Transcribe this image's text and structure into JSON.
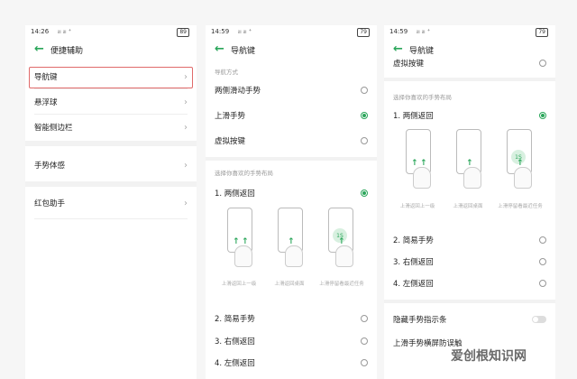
{
  "p1": {
    "status": {
      "time": "14:26",
      "signal": "ᵢₗₗ ᵢₗₗ ⁺",
      "battery": "89"
    },
    "title": "便捷辅助",
    "items": [
      {
        "label": "导航键"
      },
      {
        "label": "悬浮球"
      },
      {
        "label": "智能侧边栏"
      },
      {
        "label": "手势体感"
      },
      {
        "label": "红包助手"
      }
    ]
  },
  "p2": {
    "status": {
      "time": "14:59",
      "signal": "ᵢₗₗ ᵢₗₗ ⁺",
      "battery": "79"
    },
    "title": "导航键",
    "section1": "导航方式",
    "modes": [
      {
        "label": "两侧滑动手势",
        "on": false
      },
      {
        "label": "上滑手势",
        "on": true
      },
      {
        "label": "虚拟按键",
        "on": false
      }
    ],
    "section2": "选择你喜欢的手势布局",
    "layouts": [
      {
        "label": "1. 两侧返回",
        "on": true
      },
      {
        "label": "2. 简易手势",
        "on": false
      },
      {
        "label": "3. 右侧返回",
        "on": false
      },
      {
        "label": "4. 左侧返回",
        "on": false
      }
    ],
    "captions": [
      "上滑返回上一级",
      "上滑返回桌面",
      "上滑停留看最近任务"
    ],
    "circle": "1S"
  },
  "p3": {
    "status": {
      "time": "14:59",
      "signal": "ᵢₗₗ ᵢₗₗ ⁺",
      "battery": "79"
    },
    "title": "导航键",
    "top_item": "虚拟按键",
    "section2": "选择你喜欢的手势布局",
    "layouts": [
      {
        "label": "1. 两侧返回",
        "on": true
      },
      {
        "label": "2. 简易手势",
        "on": false
      },
      {
        "label": "3. 右侧返回",
        "on": false
      },
      {
        "label": "4. 左侧返回",
        "on": false
      }
    ],
    "captions": [
      "上滑返回上一级",
      "上滑返回桌面",
      "上滑停留看最近任务"
    ],
    "circle": "1S",
    "toggle1": "隐藏手势指示条",
    "toggle2": "上滑手势横屏防误触"
  },
  "watermark": "爱创根知识网"
}
